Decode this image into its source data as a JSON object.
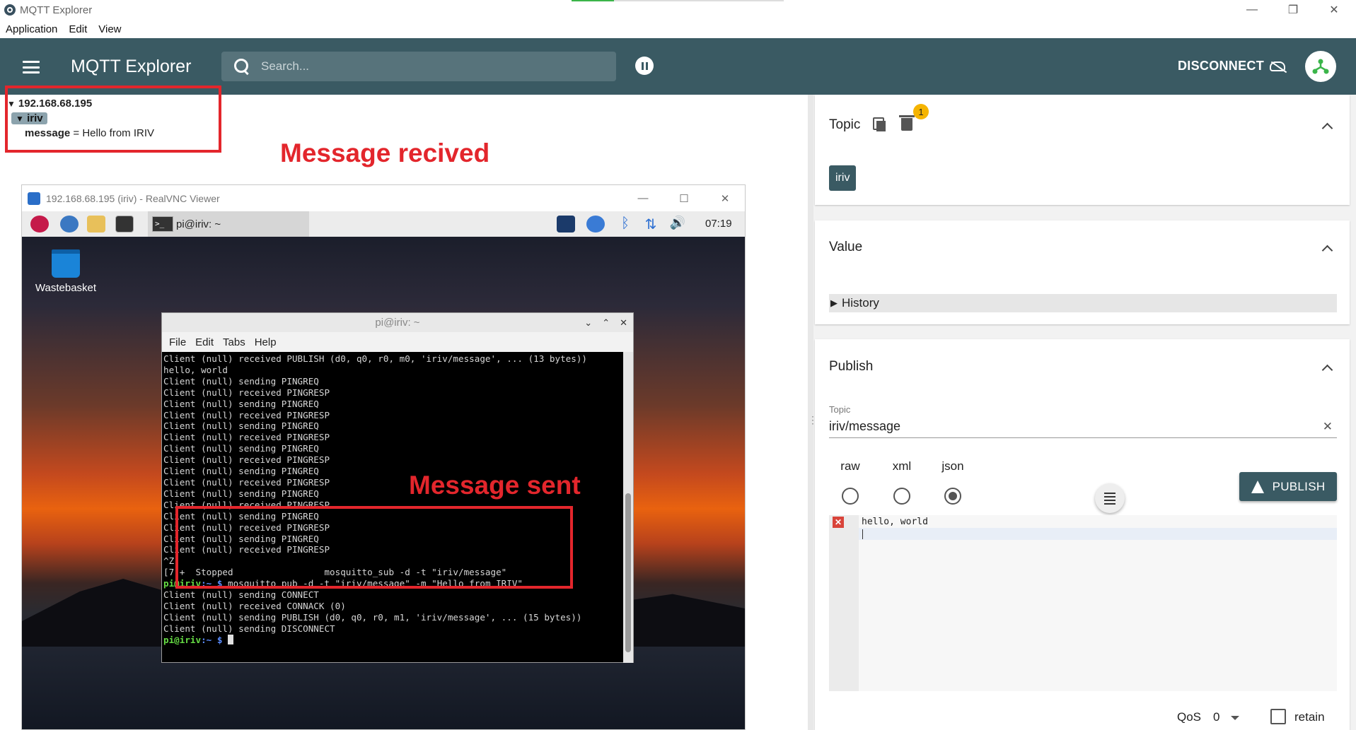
{
  "window": {
    "title": "MQTT Explorer",
    "minimize": "—",
    "maximize": "❐",
    "close": "✕"
  },
  "menu": [
    "Application",
    "Edit",
    "View"
  ],
  "header": {
    "app_name": "MQTT Explorer",
    "search_placeholder": "Search...",
    "disconnect_label": "DISCONNECT"
  },
  "tree": {
    "host": "192.168.68.195",
    "node": "iriv",
    "leaf_key": "message",
    "leaf_sep": " = ",
    "leaf_value": "Hello from IRIV",
    "arrow": "▼",
    "arrow_host": "▾"
  },
  "annotations": {
    "received": "Message recived",
    "sent": "Message sent"
  },
  "vnc": {
    "title": "192.168.68.195 (iriv) - RealVNC Viewer",
    "task_label": "pi@iriv: ~",
    "clock": "07:19",
    "desktop_icon": "Wastebasket",
    "terminal": {
      "title": "pi@iriv: ~",
      "menu": [
        "File",
        "Edit",
        "Tabs",
        "Help"
      ],
      "lines": [
        "Client (null) received PUBLISH (d0, q0, r0, m0, 'iriv/message', ... (13 bytes))",
        "hello, world",
        "",
        "Client (null) sending PINGREQ",
        "Client (null) received PINGRESP",
        "Client (null) sending PINGREQ",
        "Client (null) received PINGRESP",
        "Client (null) sending PINGREQ",
        "Client (null) received PINGRESP",
        "Client (null) sending PINGREQ",
        "Client (null) received PINGRESP",
        "Client (null) sending PINGREQ",
        "Client (null) received PINGRESP",
        "Client (null) sending PINGREQ",
        "Client (null) received PINGRESP",
        "Client (null) sending PINGREQ",
        "Client (null) received PINGRESP",
        "Client (null) sending PINGREQ",
        "Client (null) received PINGRESP",
        "^Z",
        "[7]+  Stopped                 mosquitto_sub -d -t \"iriv/message\""
      ],
      "cmd_prompt": "pi@iriv",
      "cmd_path": ":~ $ ",
      "cmd": "mosquitto_pub -d -t \"iriv/message\" -m \"Hello from IRIV\"",
      "lines_after": [
        "Client (null) sending CONNECT",
        "Client (null) received CONNACK (0)",
        "Client (null) sending PUBLISH (d0, q0, r0, m1, 'iriv/message', ... (15 bytes))",
        "Client (null) sending DISCONNECT"
      ],
      "final_prompt": "pi@iriv",
      "final_path": ":~ $ "
    }
  },
  "panel": {
    "topic_title": "Topic",
    "topic_badge": "1",
    "topic_chip": "iriv",
    "value_title": "Value",
    "history_label": "History",
    "publish_title": "Publish",
    "pub_topic_label": "Topic",
    "pub_topic_value": "iriv/message",
    "clear": "✕",
    "formats": [
      "raw",
      "xml",
      "json"
    ],
    "selected_format": "json",
    "publish_button": "PUBLISH",
    "editor_text": "hello, world",
    "editor_error": "✕",
    "qos_label": "QoS",
    "qos_value": "0",
    "retain_label": "retain"
  }
}
